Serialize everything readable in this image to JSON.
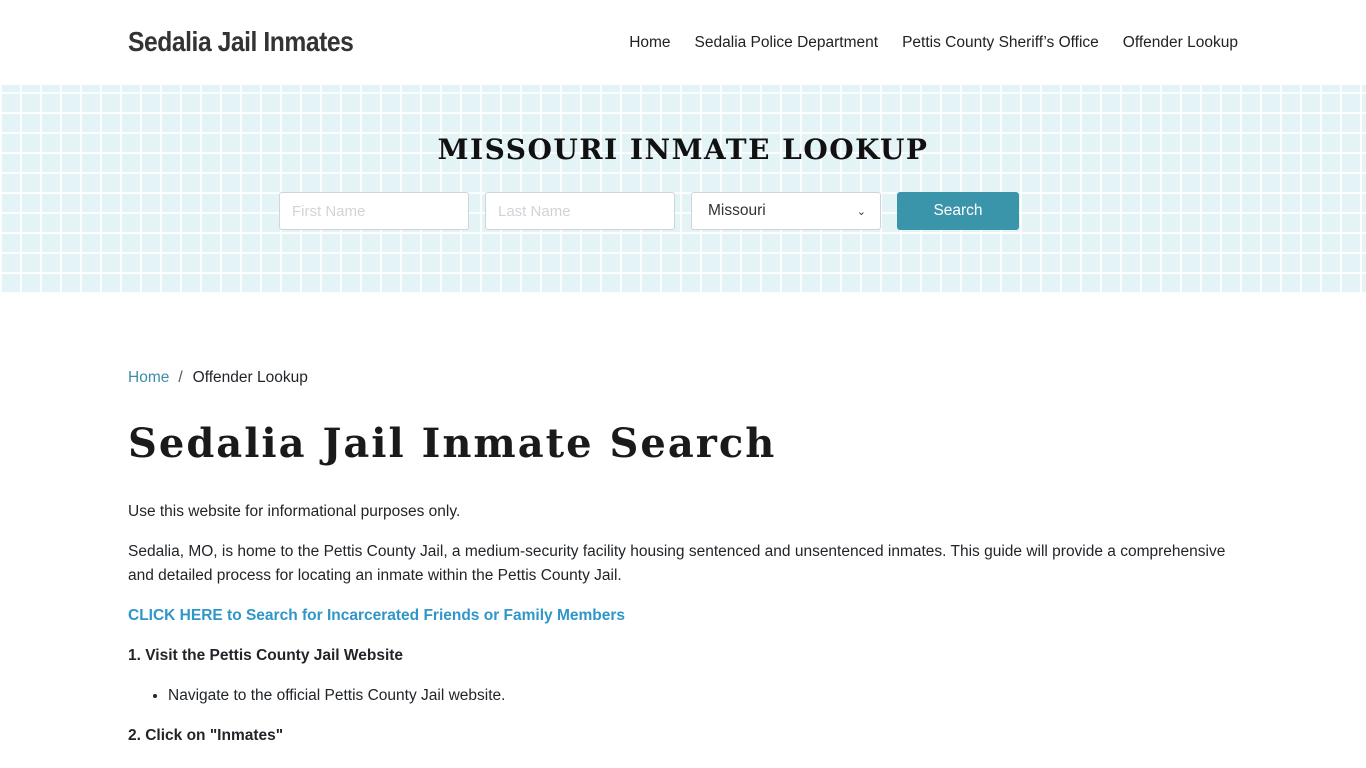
{
  "header": {
    "brand": "Sedalia Jail Inmates",
    "nav": [
      {
        "label": "Home"
      },
      {
        "label": "Sedalia Police Department"
      },
      {
        "label": "Pettis County Sheriff’s Office"
      },
      {
        "label": "Offender Lookup"
      }
    ]
  },
  "hero": {
    "title": "MISSOURI INMATE LOOKUP",
    "first_name_placeholder": "First Name",
    "last_name_placeholder": "Last Name",
    "state_selected": "Missouri",
    "search_label": "Search",
    "accent_color": "#3a94aa"
  },
  "breadcrumb": {
    "home": "Home",
    "separator": "/",
    "current": "Offender Lookup"
  },
  "page": {
    "title": "Sedalia Jail Inmate Search",
    "intro": "Use this website for informational purposes only.",
    "description": "Sedalia, MO, is home to the Pettis County Jail, a medium-security facility housing sentenced and unsentenced inmates. This guide will provide a comprehensive and detailed process for locating an inmate within the Pettis County Jail.",
    "cta_link": "CLICK HERE to Search for Incarcerated Friends or Family Members",
    "steps": [
      {
        "heading": "1. Visit the Pettis County Jail Website",
        "bullets": [
          "Navigate to the official Pettis County Jail website."
        ]
      },
      {
        "heading": "2. Click on \"Inmates\""
      }
    ]
  }
}
